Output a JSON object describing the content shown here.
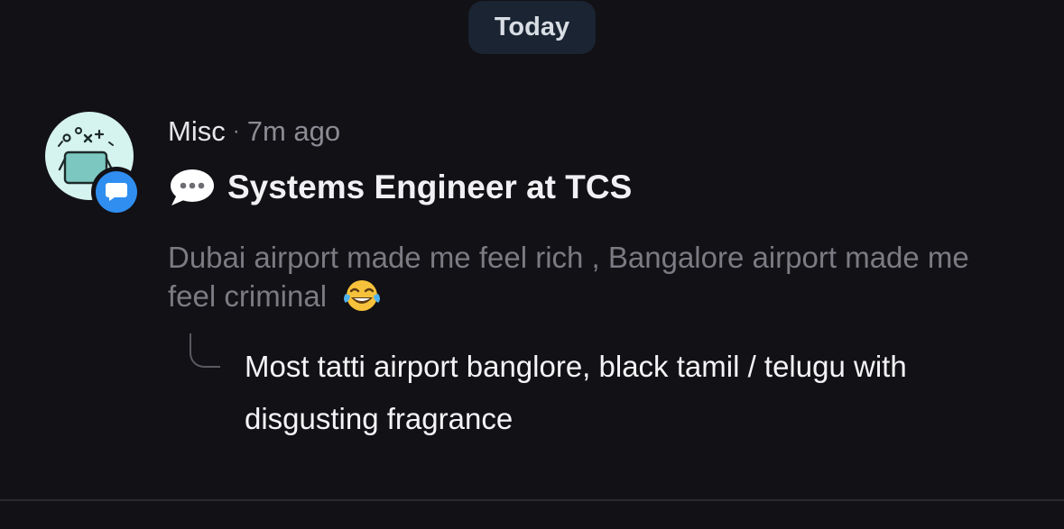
{
  "date_separator": {
    "label": "Today"
  },
  "post": {
    "avatar_icon": "tic-tac-toe-board-avatar-icon",
    "badge_icon": "chat-bubble-icon",
    "channel": "Misc",
    "separator": "·",
    "time_ago": "7m ago",
    "title_icon": "speech-bubble-emoji-icon",
    "title": "Systems Engineer at TCS",
    "body": "Dubai airport made me feel rich , Bangalore airport made me feel criminal",
    "body_emoji": "laughing-tears-emoji-icon"
  },
  "reply": {
    "icon": "reply-hook-icon",
    "text": "Most tatti airport banglore, black tamil / telugu with disgusting fragrance"
  },
  "colors": {
    "background": "#121115",
    "pill": "#1a2433",
    "avatar_bg": "#d5f3ef",
    "badge": "#2f8ef0",
    "muted_text": "#7c7a82"
  }
}
